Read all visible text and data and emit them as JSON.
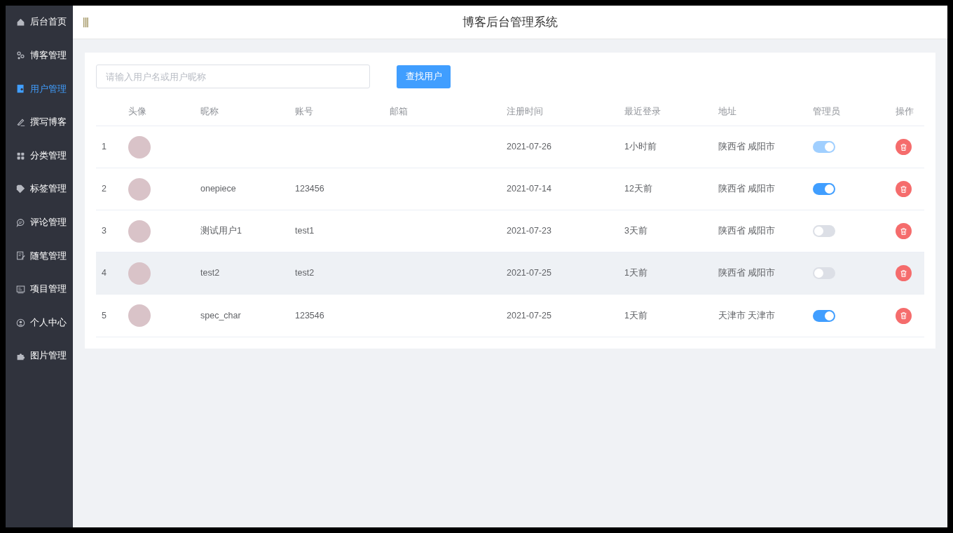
{
  "sidebar": {
    "items": [
      {
        "label": "后台首页",
        "selected": false
      },
      {
        "label": "博客管理",
        "selected": false
      },
      {
        "label": "用户管理",
        "selected": true
      },
      {
        "label": "撰写博客",
        "selected": false
      },
      {
        "label": "分类管理",
        "selected": false
      },
      {
        "label": "标签管理",
        "selected": false
      },
      {
        "label": "评论管理",
        "selected": false
      },
      {
        "label": "随笔管理",
        "selected": false
      },
      {
        "label": "项目管理",
        "selected": false
      },
      {
        "label": "个人中心",
        "selected": false
      },
      {
        "label": "图片管理",
        "selected": false
      }
    ]
  },
  "header": {
    "menu_toggle": "|||",
    "title": "博客后台管理系统"
  },
  "search": {
    "placeholder": "请输入用户名或用户昵称",
    "button": "查找用户"
  },
  "table": {
    "columns": [
      "",
      "头像",
      "昵称",
      "账号",
      "邮箱",
      "注册时间",
      "最近登录",
      "地址",
      "管理员",
      "操作"
    ],
    "rows": [
      {
        "index": "1",
        "nickname": "",
        "account": "",
        "email": "",
        "registered": "2021-07-26",
        "last_login": "1小时前",
        "address": "陕西省 咸阳市",
        "admin": true,
        "disabled": true,
        "hovered": false
      },
      {
        "index": "2",
        "nickname": "onepiece",
        "account": "123456",
        "email": "",
        "registered": "2021-07-14",
        "last_login": "12天前",
        "address": "陕西省 咸阳市",
        "admin": true,
        "disabled": false,
        "hovered": false
      },
      {
        "index": "3",
        "nickname": "测试用户1",
        "account": "test1",
        "email": "",
        "registered": "2021-07-23",
        "last_login": "3天前",
        "address": "陕西省 咸阳市",
        "admin": false,
        "disabled": false,
        "hovered": false
      },
      {
        "index": "4",
        "nickname": "test2",
        "account": "test2",
        "email": "",
        "registered": "2021-07-25",
        "last_login": "1天前",
        "address": "陕西省 咸阳市",
        "admin": false,
        "disabled": false,
        "hovered": true
      },
      {
        "index": "5",
        "nickname": "spec_char",
        "account": "123546",
        "email": "",
        "registered": "2021-07-25",
        "last_login": "1天前",
        "address": "天津市 天津市",
        "admin": true,
        "disabled": false,
        "hovered": false
      }
    ]
  }
}
